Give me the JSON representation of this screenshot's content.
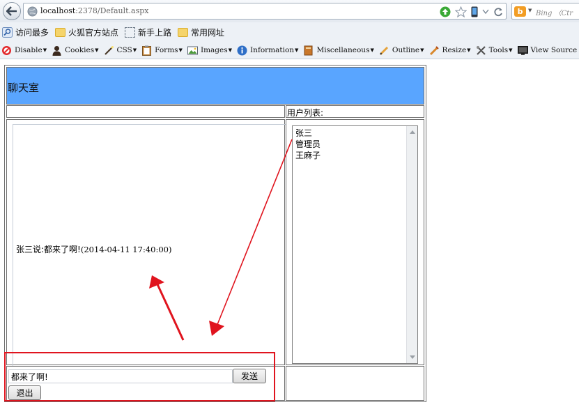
{
  "browser": {
    "url_host": "localhost",
    "url_rest": ":2378/Default.aspx",
    "search_placeholder": "Bing 〈Ctr"
  },
  "bookmarks": [
    {
      "label": "访问最多",
      "icon": "magnifier-icon"
    },
    {
      "label": "火狐官方站点",
      "icon": "folder-icon"
    },
    {
      "label": "新手上路",
      "icon": "dashed-box-icon"
    },
    {
      "label": "常用网址",
      "icon": "folder-icon"
    }
  ],
  "devtoolbar": [
    {
      "label": "Disable",
      "icon": "disable-icon"
    },
    {
      "label": "Cookies",
      "icon": "cookie-person-icon"
    },
    {
      "label": "CSS",
      "icon": "pencil-wand-icon"
    },
    {
      "label": "Forms",
      "icon": "clipboard-icon"
    },
    {
      "label": "Images",
      "icon": "picture-icon"
    },
    {
      "label": "Information",
      "icon": "info-icon"
    },
    {
      "label": "Miscellaneous",
      "icon": "book-icon"
    },
    {
      "label": "Outline",
      "icon": "pencil-icon"
    },
    {
      "label": "Resize",
      "icon": "ruler-pencil-icon"
    },
    {
      "label": "Tools",
      "icon": "tools-icon"
    },
    {
      "label": "View Source",
      "icon": "monitor-icon"
    }
  ],
  "page": {
    "title": "聊天室",
    "user_list_label": "用户列表:",
    "chat_message": "张三说:都来了啊!",
    "chat_time": "(2014-04-11 17:40:00)",
    "users": [
      "张三",
      "管理员",
      "王麻子"
    ],
    "input_value": "都来了啊!",
    "send_label": "发送",
    "exit_label": "退出"
  },
  "colors": {
    "title_bg": "#59a5ff",
    "annotation": "#e0141e"
  }
}
